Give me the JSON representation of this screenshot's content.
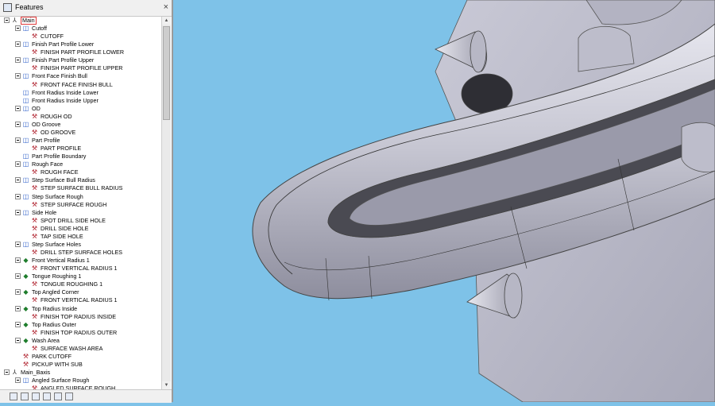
{
  "panel": {
    "title": "Features",
    "close_glyph": "×",
    "scroll_up": "▲",
    "scroll_down": "▼"
  },
  "tree": [
    {
      "label": "Main",
      "depth": 0,
      "icon": "root",
      "expander": true,
      "selected": true
    },
    {
      "label": "Cutoff",
      "depth": 1,
      "icon": "folder",
      "expander": true
    },
    {
      "label": "CUTOFF",
      "depth": 2,
      "icon": "op"
    },
    {
      "label": "Finish Part Profile Lower",
      "depth": 1,
      "icon": "folder",
      "expander": true
    },
    {
      "label": "FINISH PART PROFILE LOWER",
      "depth": 2,
      "icon": "op"
    },
    {
      "label": "Finish Part Profile Upper",
      "depth": 1,
      "icon": "folder",
      "expander": true
    },
    {
      "label": "FINISH PART PROFILE UPPER",
      "depth": 2,
      "icon": "op"
    },
    {
      "label": "Front Face Finish Bull",
      "depth": 1,
      "icon": "folder",
      "expander": true
    },
    {
      "label": "FRONT FACE FINISH BULL",
      "depth": 2,
      "icon": "op"
    },
    {
      "label": "Front Radius Inside Lower",
      "depth": 1,
      "icon": "folder",
      "expander": false
    },
    {
      "label": "Front Radius Inside Upper",
      "depth": 1,
      "icon": "folder",
      "expander": false
    },
    {
      "label": "OD",
      "depth": 1,
      "icon": "folder",
      "expander": true
    },
    {
      "label": "ROUGH OD",
      "depth": 2,
      "icon": "op"
    },
    {
      "label": "OD Groove",
      "depth": 1,
      "icon": "folder",
      "expander": true
    },
    {
      "label": "OD GROOVE",
      "depth": 2,
      "icon": "op"
    },
    {
      "label": "Part Profile",
      "depth": 1,
      "icon": "folder",
      "expander": true
    },
    {
      "label": "PART PROFILE",
      "depth": 2,
      "icon": "op"
    },
    {
      "label": "Part Profile Boundary",
      "depth": 1,
      "icon": "folder",
      "expander": false
    },
    {
      "label": "Rough Face",
      "depth": 1,
      "icon": "folder",
      "expander": true
    },
    {
      "label": "ROUGH FACE",
      "depth": 2,
      "icon": "op"
    },
    {
      "label": "Step Surface Bull Radius",
      "depth": 1,
      "icon": "folder",
      "expander": true
    },
    {
      "label": "STEP SURFACE BULL RADIUS",
      "depth": 2,
      "icon": "op"
    },
    {
      "label": "Step Surface Rough",
      "depth": 1,
      "icon": "folder",
      "expander": true
    },
    {
      "label": "STEP SURFACE ROUGH",
      "depth": 2,
      "icon": "op"
    },
    {
      "label": "Side Hole",
      "depth": 1,
      "icon": "folder",
      "expander": true
    },
    {
      "label": "SPOT DRILL SIDE HOLE",
      "depth": 2,
      "icon": "op"
    },
    {
      "label": "DRILL SIDE HOLE",
      "depth": 2,
      "icon": "op"
    },
    {
      "label": "TAP SIDE HOLE",
      "depth": 2,
      "icon": "op"
    },
    {
      "label": "Step Surface Holes",
      "depth": 1,
      "icon": "folder",
      "expander": true
    },
    {
      "label": "DRILL STEP SURFACE HOLES",
      "depth": 2,
      "icon": "op"
    },
    {
      "label": "Front Vertical Radius 1",
      "depth": 1,
      "icon": "mill",
      "expander": true
    },
    {
      "label": "FRONT VERTICAL RADIUS 1",
      "depth": 2,
      "icon": "op"
    },
    {
      "label": "Tongue Roughing 1",
      "depth": 1,
      "icon": "mill",
      "expander": true
    },
    {
      "label": "TONGUE ROUGHING 1",
      "depth": 2,
      "icon": "op"
    },
    {
      "label": "Top Angled Corner",
      "depth": 1,
      "icon": "mill",
      "expander": true
    },
    {
      "label": "FRONT VERTICAL RADIUS 1",
      "depth": 2,
      "icon": "op"
    },
    {
      "label": "Top Radius Inside",
      "depth": 1,
      "icon": "mill",
      "expander": true
    },
    {
      "label": "FINISH TOP RADIUS INSIDE",
      "depth": 2,
      "icon": "op"
    },
    {
      "label": "Top Radius Outer",
      "depth": 1,
      "icon": "mill",
      "expander": true
    },
    {
      "label": "FINISH TOP RADIUS OUTER",
      "depth": 2,
      "icon": "op"
    },
    {
      "label": "Wash Area",
      "depth": 1,
      "icon": "mill",
      "expander": true
    },
    {
      "label": "SURFACE WASH AREA",
      "depth": 2,
      "icon": "op"
    },
    {
      "label": "PARK CUTOFF",
      "depth": 1,
      "icon": "op",
      "expander": false
    },
    {
      "label": "PICKUP WITH SUB",
      "depth": 1,
      "icon": "op",
      "expander": false
    },
    {
      "label": "Main_Baxis",
      "depth": 0,
      "icon": "root",
      "expander": true
    },
    {
      "label": "Angled Surface Rough",
      "depth": 1,
      "icon": "folder",
      "expander": true
    },
    {
      "label": "ANGLED SURFACE ROUGH",
      "depth": 2,
      "icon": "op"
    }
  ],
  "icons": {
    "root": "⅄",
    "folder": "◫",
    "op": "⚒",
    "mill": "◆"
  },
  "toolbar": [
    "features-tab",
    "operations-tab",
    "tools-tab",
    "document-tab",
    "properties-tab",
    "layers-tab"
  ],
  "colors": {
    "viewport_bg": "#7ec2e8",
    "part_body": "#b9b9c9",
    "selection": "#e03a3a"
  }
}
